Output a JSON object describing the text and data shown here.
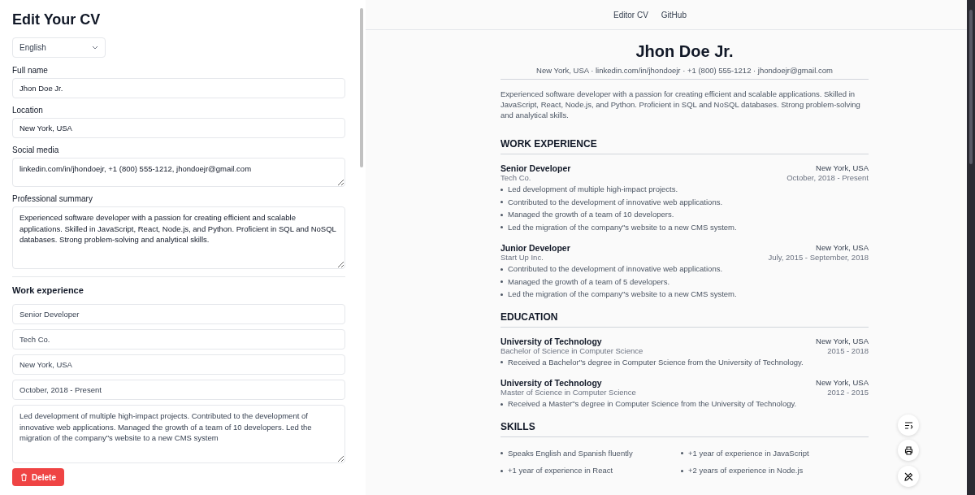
{
  "editor": {
    "title": "Edit Your CV",
    "language": "English",
    "fields": [
      {
        "label": "Full name",
        "value": "Jhon Doe Jr.",
        "kind": "input"
      },
      {
        "label": "Location",
        "value": "New York, USA",
        "kind": "input"
      },
      {
        "label": "Social media",
        "value": "linkedin.com/in/jhondoejr, +1 (800) 555-1212, jhondoejr@gmail.com",
        "kind": "textarea"
      },
      {
        "label": "Professional summary",
        "value": "Experienced software developer with a passion for creating efficient and scalable applications. Skilled in JavaScript, React, Node.js, and Python. Proficient in SQL and NoSQL databases. Strong problem-solving and analytical skills.",
        "kind": "textarea"
      }
    ],
    "work_title": "Work experience",
    "work_fields": [
      {
        "value": "Senior Developer",
        "kind": "input"
      },
      {
        "value": "Tech Co.",
        "kind": "input"
      },
      {
        "value": "New York, USA",
        "kind": "input"
      },
      {
        "value": "October, 2018 - Present",
        "kind": "input"
      },
      {
        "value": "Led development of multiple high-impact projects. Contributed to the development of innovative web applications. Managed the growth of a team of 10 developers. Led the migration of the company\"s website to a new CMS system",
        "kind": "textarea"
      }
    ],
    "delete_button": "Delete"
  },
  "nav": [
    "Editor CV",
    "GitHub"
  ],
  "cv": {
    "name": "Jhon Doe Jr.",
    "contact": "New York, USA · linkedin.com/in/jhondoejr · +1 (800) 555-1212 · jhondoejr@gmail.com",
    "summary": "Experienced software developer with a passion for creating efficient and scalable applications. Skilled in JavaScript, React, Node.js, and Python. Proficient in SQL and NoSQL databases. Strong problem-solving and analytical skills.",
    "sections": [
      {
        "title": "WORK EXPERIENCE",
        "entries": [
          {
            "title": "Senior Developer",
            "subtitle": "Tech Co.",
            "location": "New York, USA",
            "dates": "October, 2018 - Present",
            "bullets": [
              "Led development of multiple high-impact projects.",
              "Contributed to the development of innovative web applications.",
              "Managed the growth of a team of 10 developers.",
              "Led the migration of the company\"s website to a new CMS system."
            ]
          },
          {
            "title": "Junior Developer",
            "subtitle": "Start Up Inc.",
            "location": "New York, USA",
            "dates": "July, 2015 - September, 2018",
            "bullets": [
              "Contributed to the development of innovative web applications.",
              "Managed the growth of a team of 5 developers.",
              "Led the migration of the company\"s website to a new CMS system."
            ]
          }
        ]
      },
      {
        "title": "EDUCATION",
        "entries": [
          {
            "title": "University of Technology",
            "subtitle": "Bachelor of Science in Computer Science",
            "location": "New York, USA",
            "dates": "2015 - 2018",
            "bullets": [
              "Received a Bachelor\"s degree in Computer Science from the University of Technology."
            ]
          },
          {
            "title": "University of Technology",
            "subtitle": "Master of Science in Computer Science",
            "location": "New York, USA",
            "dates": "2012 - 2015",
            "bullets": [
              "Received a Master\"s degree in Computer Science from the University of Technology."
            ]
          }
        ]
      }
    ],
    "skills_title": "SKILLS",
    "skills": [
      "Speaks English and Spanish fluently",
      "+1 year of experience in JavaScript",
      "+1 year of experience in React",
      "+2 years of experience in Node.js"
    ]
  }
}
